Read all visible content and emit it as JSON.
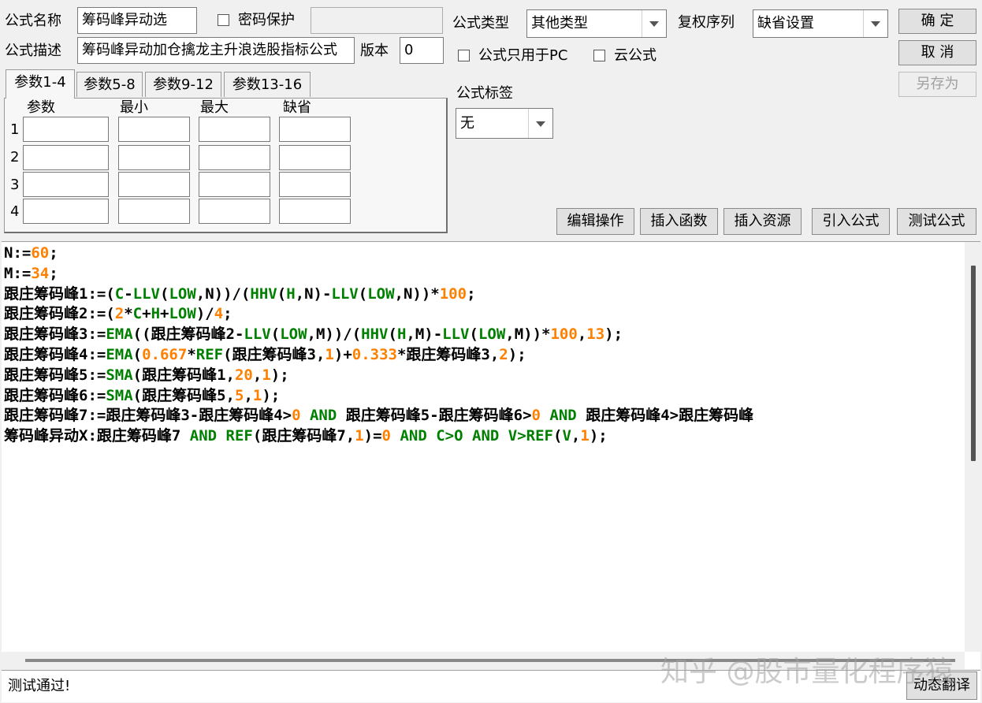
{
  "form": {
    "name_label": "公式名称",
    "name_value": "筹码峰异动选",
    "password_label": "密码保护",
    "desc_label": "公式描述",
    "desc_value": "筹码峰异动加仓擒龙主升浪选股指标公式",
    "version_label": "版本",
    "version_value": "0",
    "type_label": "公式类型",
    "type_value": "其他类型",
    "rights_label": "复权序列",
    "rights_value": "缺省设置",
    "pc_only_label": "公式只用于PC",
    "cloud_label": "云公式",
    "tag_label": "公式标签",
    "tag_value": "无"
  },
  "buttons": {
    "ok": "确  定",
    "cancel": "取  消",
    "save_as": "另存为",
    "edit_ops": "编辑操作",
    "insert_func": "插入函数",
    "insert_res": "插入资源",
    "import_formula": "引入公式",
    "test_formula": "测试公式",
    "dynamic_translate": "动态翻译"
  },
  "params": {
    "tabs": [
      "参数1-4",
      "参数5-8",
      "参数9-12",
      "参数13-16"
    ],
    "headers": [
      "参数",
      "最小",
      "最大",
      "缺省"
    ],
    "rows": [
      "1",
      "2",
      "3",
      "4"
    ]
  },
  "colors": {
    "default": "#000000",
    "number": "#ff8000",
    "function": "#008000"
  },
  "code_lines": [
    [
      [
        "N:=",
        "d"
      ],
      [
        "60",
        "n"
      ],
      [
        ";",
        "d"
      ]
    ],
    [
      [
        "M:=",
        "d"
      ],
      [
        "34",
        "n"
      ],
      [
        ";",
        "d"
      ]
    ],
    [
      [
        "跟庄筹码峰1:=(",
        "d"
      ],
      [
        "C",
        "f"
      ],
      [
        "-",
        "d"
      ],
      [
        "LLV",
        "f"
      ],
      [
        "(",
        "d"
      ],
      [
        "LOW",
        "f"
      ],
      [
        ",N))/(",
        "d"
      ],
      [
        "HHV",
        "f"
      ],
      [
        "(",
        "d"
      ],
      [
        "H",
        "f"
      ],
      [
        ",N)-",
        "d"
      ],
      [
        "LLV",
        "f"
      ],
      [
        "(",
        "d"
      ],
      [
        "LOW",
        "f"
      ],
      [
        ",N))*",
        "d"
      ],
      [
        "100",
        "n"
      ],
      [
        ";",
        "d"
      ]
    ],
    [
      [
        "跟庄筹码峰2:=(",
        "d"
      ],
      [
        "2",
        "n"
      ],
      [
        "*",
        "d"
      ],
      [
        "C",
        "f"
      ],
      [
        "+",
        "d"
      ],
      [
        "H",
        "f"
      ],
      [
        "+",
        "d"
      ],
      [
        "LOW",
        "f"
      ],
      [
        ")/",
        "d"
      ],
      [
        "4",
        "n"
      ],
      [
        ";",
        "d"
      ]
    ],
    [
      [
        "跟庄筹码峰3:=",
        "d"
      ],
      [
        "EMA",
        "f"
      ],
      [
        "((跟庄筹码峰2-",
        "d"
      ],
      [
        "LLV",
        "f"
      ],
      [
        "(",
        "d"
      ],
      [
        "LOW",
        "f"
      ],
      [
        ",M))/(",
        "d"
      ],
      [
        "HHV",
        "f"
      ],
      [
        "(",
        "d"
      ],
      [
        "H",
        "f"
      ],
      [
        ",M)-",
        "d"
      ],
      [
        "LLV",
        "f"
      ],
      [
        "(",
        "d"
      ],
      [
        "LOW",
        "f"
      ],
      [
        ",M))*",
        "d"
      ],
      [
        "100",
        "n"
      ],
      [
        ",",
        "d"
      ],
      [
        "13",
        "n"
      ],
      [
        ");",
        "d"
      ]
    ],
    [
      [
        "跟庄筹码峰4:=",
        "d"
      ],
      [
        "EMA",
        "f"
      ],
      [
        "(",
        "d"
      ],
      [
        "0.667",
        "n"
      ],
      [
        "*",
        "d"
      ],
      [
        "REF",
        "f"
      ],
      [
        "(跟庄筹码峰3,",
        "d"
      ],
      [
        "1",
        "n"
      ],
      [
        ")+",
        "d"
      ],
      [
        "0.333",
        "n"
      ],
      [
        "*跟庄筹码峰3,",
        "d"
      ],
      [
        "2",
        "n"
      ],
      [
        ");",
        "d"
      ]
    ],
    [
      [
        "跟庄筹码峰5:=",
        "d"
      ],
      [
        "SMA",
        "f"
      ],
      [
        "(跟庄筹码峰1,",
        "d"
      ],
      [
        "20",
        "n"
      ],
      [
        ",",
        "d"
      ],
      [
        "1",
        "n"
      ],
      [
        ");",
        "d"
      ]
    ],
    [
      [
        "跟庄筹码峰6:=",
        "d"
      ],
      [
        "SMA",
        "f"
      ],
      [
        "(跟庄筹码峰5,",
        "d"
      ],
      [
        "5",
        "n"
      ],
      [
        ",",
        "d"
      ],
      [
        "1",
        "n"
      ],
      [
        ");",
        "d"
      ]
    ],
    [
      [
        "跟庄筹码峰7:=跟庄筹码峰3-跟庄筹码峰4>",
        "d"
      ],
      [
        "0",
        "n"
      ],
      [
        " ",
        "d"
      ],
      [
        "AND",
        "f"
      ],
      [
        " 跟庄筹码峰5-跟庄筹码峰6>",
        "d"
      ],
      [
        "0",
        "n"
      ],
      [
        " ",
        "d"
      ],
      [
        "AND",
        "f"
      ],
      [
        " 跟庄筹码峰4>跟庄筹码峰",
        "d"
      ]
    ],
    [
      [
        "筹码峰异动X:跟庄筹码峰7 ",
        "d"
      ],
      [
        "AND",
        "f"
      ],
      [
        " ",
        "d"
      ],
      [
        "REF",
        "f"
      ],
      [
        "(跟庄筹码峰7,",
        "d"
      ],
      [
        "1",
        "n"
      ],
      [
        ")=",
        "d"
      ],
      [
        "0",
        "n"
      ],
      [
        " ",
        "d"
      ],
      [
        "AND",
        "f"
      ],
      [
        " ",
        "d"
      ],
      [
        "C>O",
        "f"
      ],
      [
        " ",
        "d"
      ],
      [
        "AND",
        "f"
      ],
      [
        " ",
        "d"
      ],
      [
        "V>REF",
        "f"
      ],
      [
        "(",
        "d"
      ],
      [
        "V",
        "f"
      ],
      [
        ",",
        "d"
      ],
      [
        "1",
        "n"
      ],
      [
        ");",
        "d"
      ]
    ]
  ],
  "status_text": "测试通过!",
  "watermark": "知乎 @股市量化程序猿"
}
